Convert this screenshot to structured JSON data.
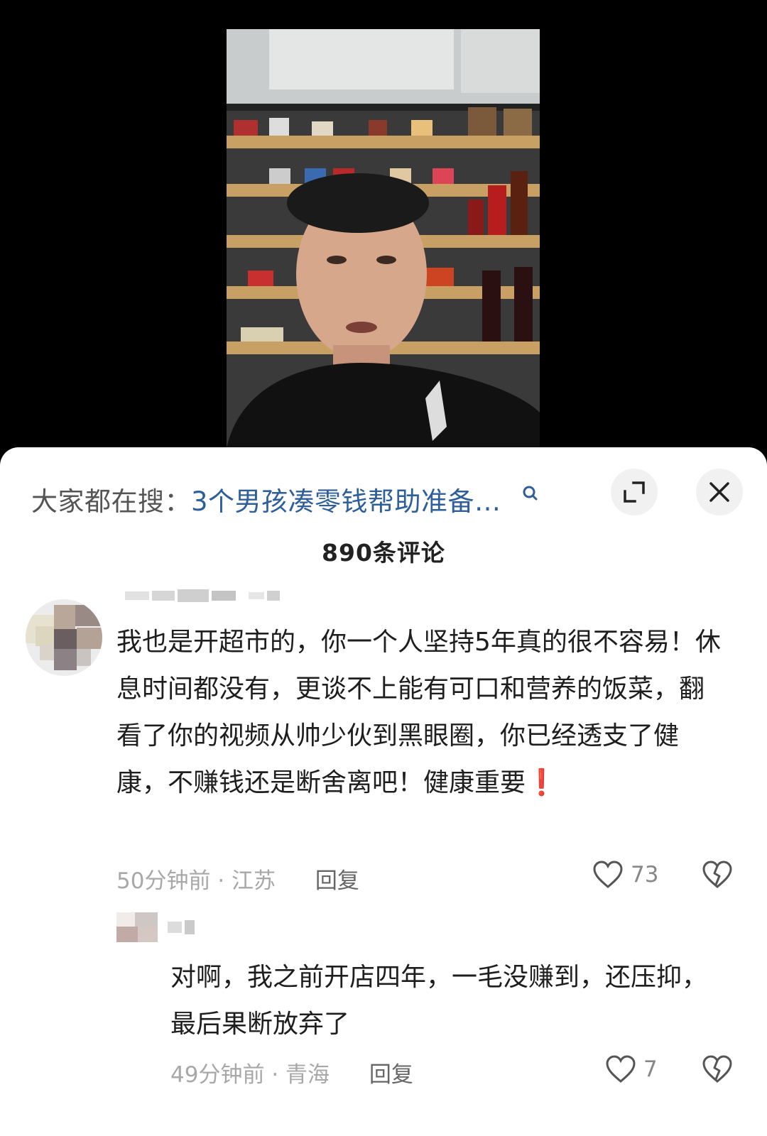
{
  "search_bar": {
    "prefix": "大家都在搜：",
    "query": "3个男孩凑零钱帮助准备…"
  },
  "comments_header": {
    "count_label": "890条评论"
  },
  "comments": [
    {
      "text_body": "我也是开超市的，你一个人坚持5年真的很不容易！休息时间都没有，更谈不上能有可口和营养的饭菜，翻看了你的视频从帅少伙到黑眼圈，你已经透支了健康，不赚钱还是断舍离吧！健康重要",
      "text_emoji": "❗",
      "time": "50分钟前",
      "location": "江苏",
      "reply_label": "回复",
      "likes": "73"
    }
  ],
  "reply": {
    "text": "对啊，我之前开店四年，一毛没赚到，还压抑，最后果断放弃了",
    "time": "49分钟前",
    "location": "青海",
    "reply_label": "回复",
    "likes": "7"
  },
  "icons": {
    "search": "search-icon",
    "expand": "expand-icon",
    "close": "close-icon",
    "like": "heart-icon",
    "dislike": "broken-heart-icon"
  },
  "colors": {
    "search_query": "#2e5f9a",
    "sheet_bg": "#ffffff",
    "emoji_red": "#e0282e"
  }
}
